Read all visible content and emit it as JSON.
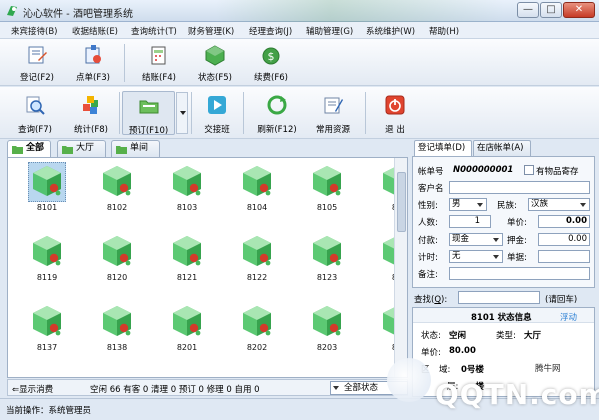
{
  "window": {
    "title": "沁心软件 - 酒吧管理系统",
    "min_glyph": "—",
    "max_glyph": "□",
    "close_glyph": "✕"
  },
  "menu": [
    "来宾接待(B)",
    "收据结账(E)",
    "查询统计(T)",
    "财务管理(K)",
    "经理查询(J)",
    "辅助管理(G)",
    "系统维护(W)",
    "帮助(H)"
  ],
  "toolbar1": [
    {
      "label": "登记(F2)",
      "icon": "register-icon"
    },
    {
      "label": "点单(F3)",
      "icon": "order-icon"
    },
    {
      "label": "结账(F4)",
      "icon": "checkout-icon"
    },
    {
      "label": "状态(F5)",
      "icon": "status-icon"
    },
    {
      "label": "续费(F6)",
      "icon": "renew-icon"
    }
  ],
  "toolbar2": [
    {
      "label": "查询(F7)",
      "icon": "search-icon"
    },
    {
      "label": "统计(F8)",
      "icon": "stats-icon"
    },
    {
      "label": "预订(F10)",
      "icon": "reserve-icon"
    },
    {
      "label": "交接班",
      "icon": "shift-icon"
    },
    {
      "label": "刷新(F12)",
      "icon": "refresh-icon"
    },
    {
      "label": "常用资源",
      "icon": "resources-icon"
    },
    {
      "label": "退  出",
      "icon": "exit-icon"
    }
  ],
  "left_tabs": [
    "全部",
    "大厅",
    "单间"
  ],
  "rooms": [
    "8101",
    "8102",
    "8103",
    "8104",
    "8105",
    "81",
    "8119",
    "8120",
    "8121",
    "8122",
    "8123",
    "81",
    "8137",
    "8138",
    "8201",
    "8202",
    "8203",
    "82"
  ],
  "status_strip": {
    "show_consumption": "显示消费",
    "counts": "空闲  66  有客  0  清理  0  预订 0  修理 0  自用 0",
    "state_select": "全部状态"
  },
  "bottom": {
    "operator": "当前操作：系统管理员"
  },
  "right_tabs": [
    "登记填单(D)",
    "在店帐单(A)"
  ],
  "form": {
    "bill_no_label": "帐单号",
    "bill_no": "N000000001",
    "deposit_checkbox": "有物品寄存",
    "customer_label": "客户名",
    "customer": "",
    "gender_label": "性别:",
    "gender": "男",
    "ethnicity_label": "民族:",
    "ethnicity": "汉族",
    "people_label": "人数:",
    "people": "1",
    "unit_price_label": "单价:",
    "unit_price": "0.00",
    "payment_label": "付款:",
    "payment": "现金",
    "deposit_label": "押金:",
    "deposit": "0.00",
    "billing_label": "计时:",
    "billing": "无",
    "docs_label": "单据:",
    "docs": "",
    "remark_label": "备注:",
    "remark": ""
  },
  "find": {
    "label": "查找(",
    "hotkey": "Q",
    "label_end": "):",
    "placeholder": "",
    "hint": "(请回车)"
  },
  "info": {
    "title": "8101 状态信息",
    "float": "浮动",
    "state_label": "状态:",
    "state": "空闲",
    "type_label": "类型:",
    "type": "大厅",
    "price_label": "单价:",
    "price": "80.00",
    "zone_label": "区",
    "zone_partial": "域:",
    "zone": "0号楼",
    "floor_label": "层:",
    "floor": "一楼"
  },
  "watermark": {
    "text": "QQTN.com",
    "small": "腾牛网"
  },
  "colors": {
    "cube_green": "#3fbf5a",
    "cube_red": "#d23a2a",
    "accent": "#1f4e8c"
  }
}
